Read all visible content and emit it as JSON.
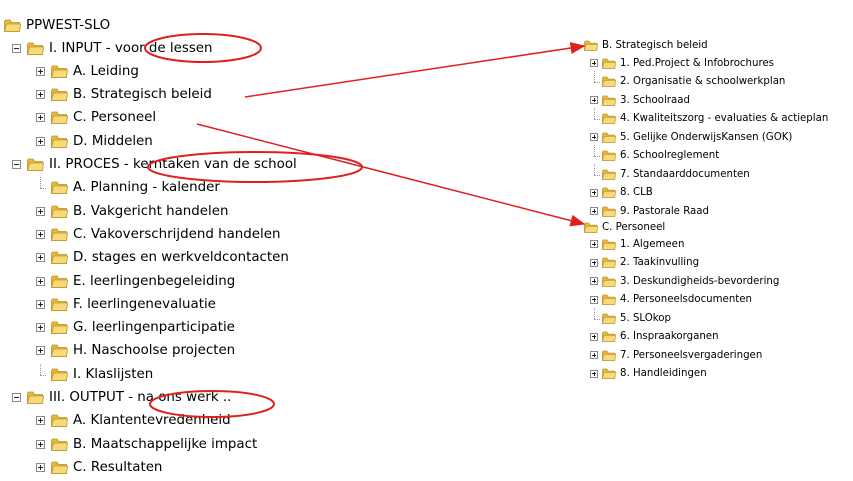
{
  "left_tree": {
    "root": "PPWEST-SLO",
    "items": [
      {
        "label": "I. INPUT - voor de lessen",
        "toggle": "minus",
        "level": 1
      },
      {
        "label": "A. Leiding",
        "toggle": "plus",
        "level": 2
      },
      {
        "label": "B. Strategisch beleid",
        "toggle": "plus",
        "level": 2
      },
      {
        "label": "C. Personeel",
        "toggle": "plus",
        "level": 2
      },
      {
        "label": "D. Middelen",
        "toggle": "plus",
        "level": 2
      },
      {
        "label": "II. PROCES - kerntaken van de school",
        "toggle": "minus",
        "level": 1
      },
      {
        "label": "A. Planning - kalender",
        "toggle": "leaf",
        "level": 2
      },
      {
        "label": "B. Vakgericht handelen",
        "toggle": "plus",
        "level": 2
      },
      {
        "label": "C. Vakoverschrijdend handelen",
        "toggle": "plus",
        "level": 2
      },
      {
        "label": "D. stages en werkveldcontacten",
        "toggle": "plus",
        "level": 2
      },
      {
        "label": "E. leerlingenbegeleiding",
        "toggle": "plus",
        "level": 2
      },
      {
        "label": "F. leerlingenevaluatie",
        "toggle": "plus",
        "level": 2
      },
      {
        "label": "G. leerlingenparticipatie",
        "toggle": "plus",
        "level": 2
      },
      {
        "label": "H. Naschoolse projecten",
        "toggle": "plus",
        "level": 2
      },
      {
        "label": "I. Klaslijsten",
        "toggle": "leaf",
        "level": 2
      },
      {
        "label": "III. OUTPUT - na ons werk ..",
        "toggle": "minus",
        "level": 1
      },
      {
        "label": "A. Klantentevredenheid",
        "toggle": "plus",
        "level": 2
      },
      {
        "label": "B. Maatschappelijke impact",
        "toggle": "plus",
        "level": 2
      },
      {
        "label": "C. Resultaten",
        "toggle": "plus",
        "level": 2
      }
    ]
  },
  "right_tree_strategisch": {
    "title": "B. Strategisch beleid",
    "items": [
      {
        "label": "1. Ped.Project & Infobrochures",
        "toggle": "plus"
      },
      {
        "label": "2. Organisatie & schoolwerkplan",
        "toggle": "leaf"
      },
      {
        "label": "3. Schoolraad",
        "toggle": "plus"
      },
      {
        "label": "4. Kwaliteitszorg - evaluaties & actieplan",
        "toggle": "leaf"
      },
      {
        "label": "5. Gelijke OnderwijsKansen (GOK)",
        "toggle": "plus"
      },
      {
        "label": "6. Schoolreglement",
        "toggle": "leaf"
      },
      {
        "label": "7. Standaarddocumenten",
        "toggle": "leaf"
      },
      {
        "label": "8. CLB",
        "toggle": "plus"
      },
      {
        "label": "9. Pastorale Raad",
        "toggle": "plus"
      }
    ]
  },
  "right_tree_personeel": {
    "title": "C. Personeel",
    "items": [
      {
        "label": "1. Algemeen",
        "toggle": "plus"
      },
      {
        "label": "2. Taakinvulling",
        "toggle": "plus"
      },
      {
        "label": "3. Deskundigheids-bevordering",
        "toggle": "plus"
      },
      {
        "label": "4. Personeelsdocumenten",
        "toggle": "plus"
      },
      {
        "label": "5. SLOkop",
        "toggle": "leaf"
      },
      {
        "label": "6. Inspraakorganen",
        "toggle": "plus"
      },
      {
        "label": "7. Personeelsvergaderingen",
        "toggle": "plus"
      },
      {
        "label": "8. Handleidingen",
        "toggle": "plus"
      }
    ]
  },
  "colors": {
    "annotation": "#e02020",
    "folder_fill": "#f5d36a",
    "folder_edge": "#b8922a"
  },
  "icons": {
    "folder": "folder-icon",
    "expand": "plus-box-icon",
    "collapse": "minus-box-icon"
  }
}
